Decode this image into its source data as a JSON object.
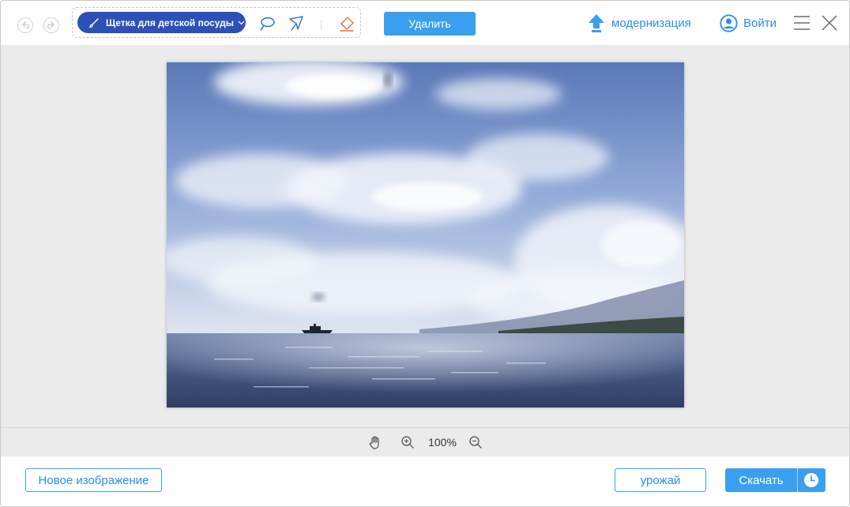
{
  "toolbar": {
    "brush_label": "Щетка для детской посуды",
    "delete_label": "Удалить"
  },
  "header": {
    "upgrade_label": "модернизация",
    "login_label": "Войти"
  },
  "zoom": {
    "level": "100%"
  },
  "footer": {
    "new_image_label": "Новое изображение",
    "harvest_label": "урожай",
    "download_label": "Скачать"
  },
  "icons": {
    "undo": "undo-icon",
    "redo": "redo-icon",
    "brush": "brush-icon",
    "lasso": "lasso-icon",
    "polygon": "polygon-lasso-icon",
    "eraser": "eraser-icon",
    "upgrade": "upload-arrow-icon",
    "login": "user-icon",
    "menu": "menu-icon",
    "close": "close-icon",
    "hand": "hand-icon",
    "zoom_in": "zoom-in-icon",
    "zoom_out": "zoom-out-icon",
    "clock": "clock-icon"
  },
  "colors": {
    "accent": "#3b9ff0",
    "brush_pill": "#2d4fb8",
    "link": "#2b8fe6",
    "eraser": "#e8733a",
    "canvas_bg": "#ebebeb"
  }
}
